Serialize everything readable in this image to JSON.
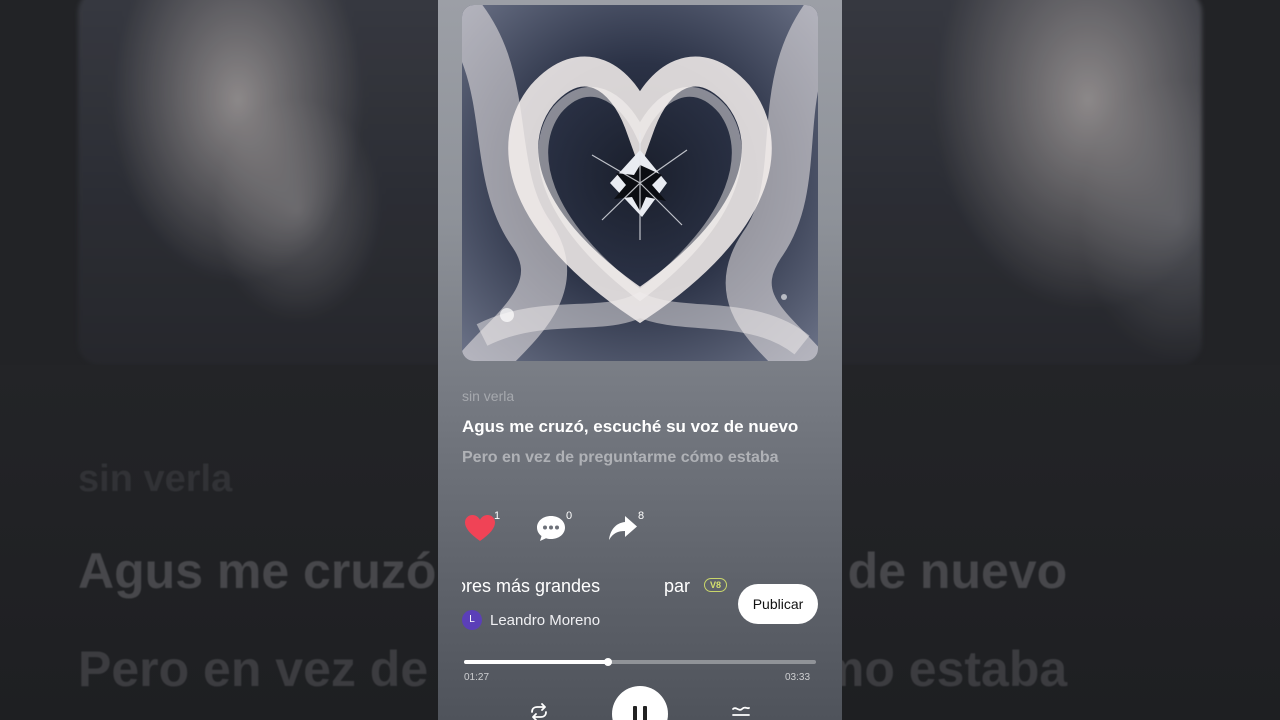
{
  "lyrics": {
    "previous": "sin verla",
    "current": "Agus me cruzó, escuché su voz de nuevo",
    "next": "Pero en vez de preguntarme cómo estaba"
  },
  "actions": {
    "like": {
      "icon": "heart-icon",
      "count": "1",
      "color": "#f04356"
    },
    "comment": {
      "icon": "comment-icon",
      "count": "0"
    },
    "share": {
      "icon": "share-icon",
      "count": "8"
    }
  },
  "track": {
    "title_ticker_a": "ores más grandes",
    "title_ticker_b": "par",
    "version_badge": "V8",
    "author_initial": "L",
    "author_name": "Leandro Moreno"
  },
  "publish_label": "Publicar",
  "playback": {
    "current_time": "01:27",
    "total_time": "03:33",
    "progress": 0.41,
    "state": "playing"
  },
  "background": {
    "blur_line_1": "sin verla",
    "blur_line_2": "Agus me cruzó, escuché su voz de nuevo",
    "blur_line_3": "Pero en vez de preguntarme cómo estaba"
  },
  "colors": {
    "accent_like": "#f04356",
    "badge": "#d4e06e",
    "avatar": "#5b3fb8"
  }
}
